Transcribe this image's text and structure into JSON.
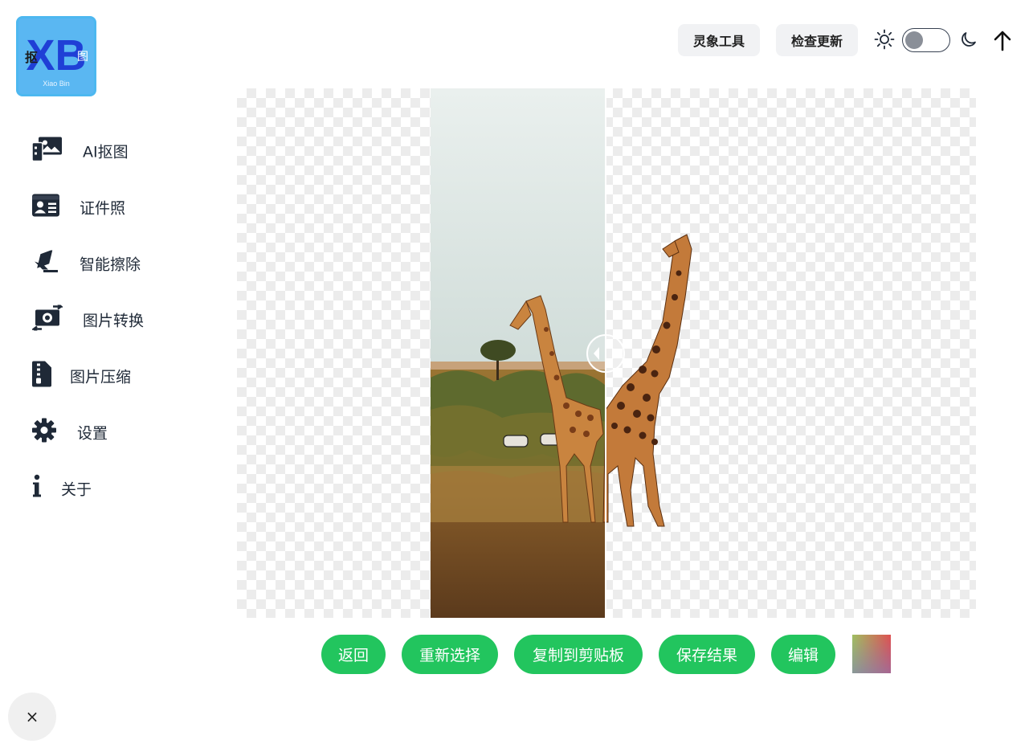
{
  "logo": {
    "big": "XB",
    "left_char": "抠",
    "right_char": "图",
    "small": "Xiao Bin"
  },
  "header": {
    "tool_button": "灵象工具",
    "update_button": "检查更新"
  },
  "sidebar": {
    "items": [
      {
        "label": "AI抠图",
        "icon": "image-cutout-icon"
      },
      {
        "label": "证件照",
        "icon": "id-card-icon"
      },
      {
        "label": "智能擦除",
        "icon": "eraser-icon"
      },
      {
        "label": "图片转换",
        "icon": "image-convert-icon"
      },
      {
        "label": "图片压缩",
        "icon": "zip-file-icon"
      },
      {
        "label": "设置",
        "icon": "gear-icon"
      },
      {
        "label": "关于",
        "icon": "info-icon"
      }
    ]
  },
  "actions": {
    "back": "返回",
    "reselect": "重新选择",
    "copy": "复制到剪贴板",
    "save": "保存结果",
    "edit": "编辑"
  },
  "close_label": "×",
  "colors": {
    "accent": "#22c55e",
    "logo_bg": "#5ab7f2",
    "logo_x": "#1f3fd6"
  }
}
